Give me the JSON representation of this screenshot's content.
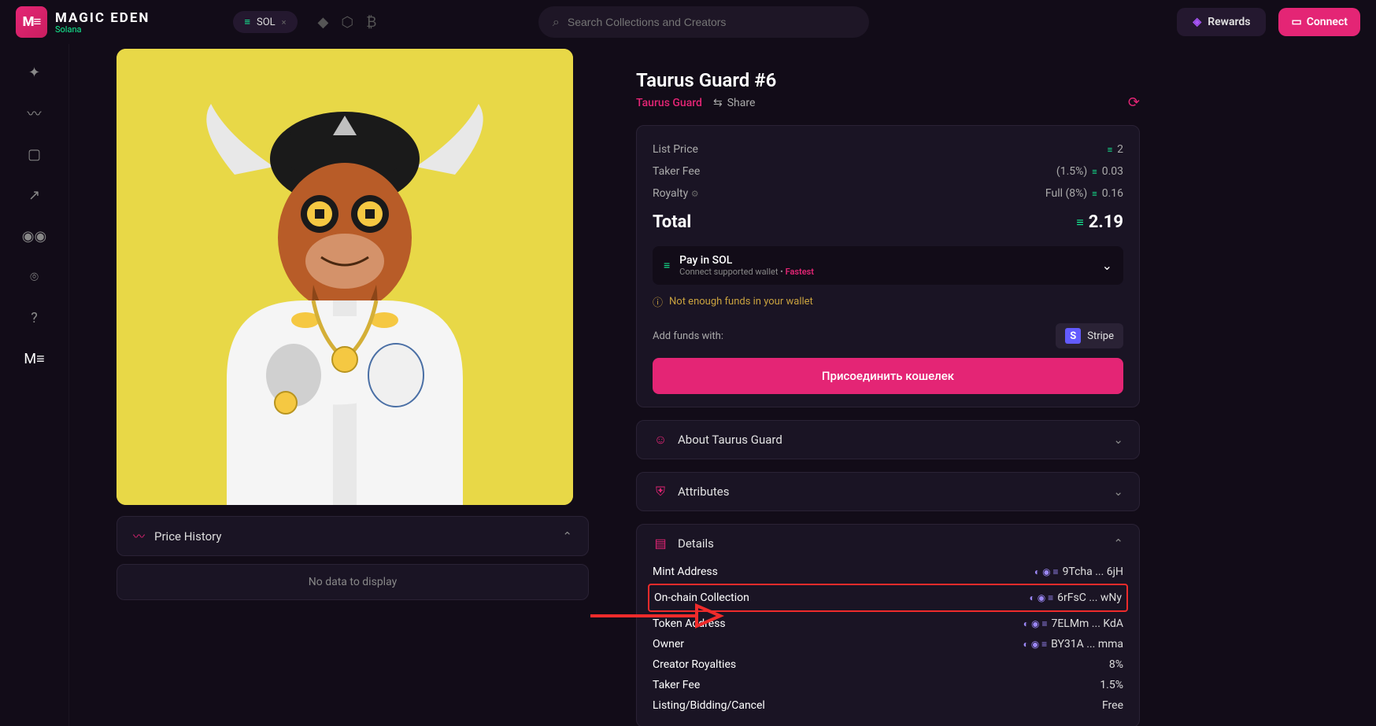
{
  "header": {
    "brand_main": "MAGIC EDEN",
    "brand_sub": "Solana",
    "chain_label": "SOL",
    "search_placeholder": "Search Collections and Creators",
    "rewards_label": "Rewards",
    "connect_label": "Connect"
  },
  "nft": {
    "title": "Taurus Guard #6",
    "collection": "Taurus Guard",
    "share_label": "Share"
  },
  "pricing": {
    "list_price_label": "List Price",
    "list_price_value": "2",
    "taker_fee_label": "Taker Fee",
    "taker_fee_pct": "(1.5%)",
    "taker_fee_value": "0.03",
    "royalty_label": "Royalty",
    "royalty_pct": "Full (8%)",
    "royalty_value": "0.16",
    "total_label": "Total",
    "total_value": "2.19",
    "pay_title": "Pay in SOL",
    "pay_sub_a": "Connect supported wallet",
    "pay_sub_fast": "Fastest",
    "warn_text": "Not enough funds in your wallet",
    "add_funds_label": "Add funds with:",
    "stripe_label": "Stripe",
    "connect_wallet_btn": "Присоединить кошелек"
  },
  "sections": {
    "about_label": "About Taurus Guard",
    "attributes_label": "Attributes",
    "details_label": "Details",
    "price_history_label": "Price History",
    "no_data": "No data to display"
  },
  "details": {
    "mint_label": "Mint Address",
    "mint_value": "9Tcha ... 6jH",
    "onchain_label": "On-chain Collection",
    "onchain_value": "6rFsC ... wNy",
    "token_label": "Token Address",
    "token_value": "7ELMm ... KdA",
    "owner_label": "Owner",
    "owner_value": "BY31A ... mma",
    "royalties_label": "Creator Royalties",
    "royalties_value": "8%",
    "takerfee_label": "Taker Fee",
    "takerfee_value": "1.5%",
    "listing_label": "Listing/Bidding/Cancel",
    "listing_value": "Free"
  }
}
